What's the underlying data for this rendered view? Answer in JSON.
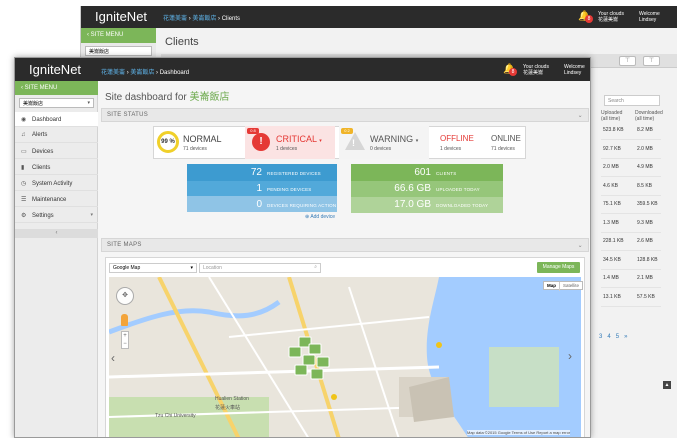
{
  "back": {
    "logo": "IgniteNet",
    "breadcrumb": [
      "花蓮美崙",
      "美崙飯店",
      "Clients"
    ],
    "notif_count": "8",
    "user_cloud_label": "Your clouds",
    "user_cloud_value": "花蓮美崙",
    "welcome_label": "Welcome",
    "welcome_user": "Lindsey",
    "site_menu": "SITE MENU",
    "site_select": "美崙飯店",
    "page_title": "Clients",
    "search_placeholder": "Search",
    "col_uploaded": "Uploaded",
    "col_uploaded_sub": "(all time)",
    "col_downloaded": "Downloaded",
    "col_downloaded_sub": "(all time)",
    "rows": [
      {
        "up": "523.8 KB",
        "down": "8.2 MB"
      },
      {
        "up": "92.7 KB",
        "down": "2.0 MB"
      },
      {
        "up": "2.0 MB",
        "down": "4.9 MB"
      },
      {
        "up": "4.6 KB",
        "down": "8.5 KB"
      },
      {
        "up": "75.1 KB",
        "down": "359.5 KB"
      },
      {
        "up": "1.3 MB",
        "down": "9.3 MB"
      },
      {
        "up": "228.1 KB",
        "down": "2.6 MB"
      },
      {
        "up": "34.5 KB",
        "down": "128.8 KB"
      },
      {
        "up": "1.4 MB",
        "down": "2.1 MB"
      },
      {
        "up": "13.1 KB",
        "down": "57.5 KB"
      }
    ],
    "pager": [
      "3",
      "4",
      "5",
      "»"
    ]
  },
  "front": {
    "logo": "IgniteNet",
    "breadcrumb": [
      "花蓮美崙",
      "美崙飯店",
      "Dashboard"
    ],
    "notif_count": "8",
    "user_cloud_label": "Your clouds",
    "user_cloud_value": "花蓮美崙",
    "welcome_label": "Welcome",
    "welcome_user": "Lindsey",
    "site_menu": "SITE MENU",
    "site_select": "美崙飯店",
    "nav": [
      {
        "label": "Dashboard",
        "icon": "dashboard-icon"
      },
      {
        "label": "Alerts",
        "icon": "bell-icon"
      },
      {
        "label": "Devices",
        "icon": "device-icon"
      },
      {
        "label": "Clients",
        "icon": "bar-chart-icon"
      },
      {
        "label": "System Activity",
        "icon": "clock-icon"
      },
      {
        "label": "Maintenance",
        "icon": "server-icon"
      },
      {
        "label": "Settings",
        "icon": "gears-icon"
      }
    ],
    "title_prefix": "Site dashboard for ",
    "title_site": "美崙飯店",
    "site_status_header": "SITE STATUS",
    "health_pct": "99 %",
    "normal_label": "NORMAL",
    "normal_sub": "71 devices",
    "critical_label": "CRITICAL",
    "critical_tag": "0 8",
    "critical_sub": "1 devices",
    "warning_label": "WARNING",
    "warning_tag": "0 2",
    "warning_sub": "0 devices",
    "offline_label": "OFFLINE",
    "offline_sub": "1 devices",
    "online_label": "ONLINE",
    "online_sub": "71 devices",
    "registered_num": "72",
    "registered_lbl": "REGISTERED DEVICES",
    "pending_num": "1",
    "pending_lbl": "PENDING DEVICES",
    "action_num": "0",
    "action_lbl": "DEVICES REQUIRING ACTION",
    "clients_num": "601",
    "clients_lbl": "CLIENTS",
    "uploaded_num": "66.6 GB",
    "uploaded_lbl": "UPLOADED TODAY",
    "downloaded_num": "17.0 GB",
    "downloaded_lbl": "DOWNLOADED TODAY",
    "add_device": "Add device",
    "site_maps_header": "SITE MAPS",
    "map_select": "Google Map",
    "location_placeholder": "Location",
    "manage_maps": "Manage Maps",
    "map_btn": "Map",
    "satellite_btn": "Satellite",
    "map_labels": [
      "Tzu Chi University",
      "花蓮火車站",
      "Hualien Station"
    ],
    "map_footer": "Map data ©2015 Google   Terms of Use   Report a map error"
  },
  "colors": {
    "green": "#7cb659",
    "blue": "#4aa3d6",
    "red": "#e53935",
    "dark": "#2b2b2b"
  }
}
